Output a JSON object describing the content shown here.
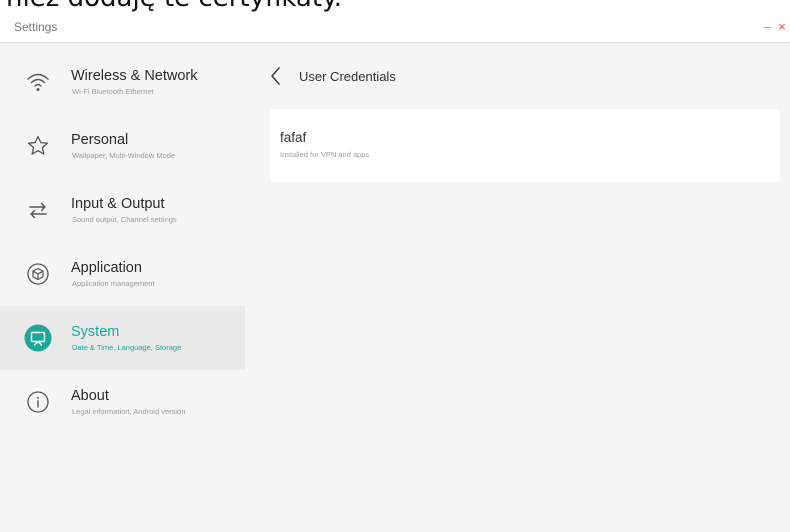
{
  "caption": {
    "text": "niez dodaję te certyfikaty."
  },
  "window": {
    "title": "Settings",
    "minimize_glyph": "–",
    "close_glyph": "×",
    "close_color": "#e0522f"
  },
  "sidebar": {
    "accent_color": "#1aa89a",
    "items": [
      {
        "icon": "wifi-icon",
        "label": "Wireless & Network",
        "sublabel": "Wi-Fi Bluetooth Ethernet",
        "active": false
      },
      {
        "icon": "star-icon",
        "label": "Personal",
        "sublabel": "Wallpaper, Multi-Window Mode",
        "active": false
      },
      {
        "icon": "swap-arrows-icon",
        "label": "Input & Output",
        "sublabel": "Sound output, Channel settings",
        "active": false
      },
      {
        "icon": "cube-icon",
        "label": "Application",
        "sublabel": "Application management",
        "active": false
      },
      {
        "icon": "monitor-icon",
        "label": "System",
        "sublabel": "Date & Time, Language, Storage",
        "active": true
      },
      {
        "icon": "info-icon",
        "label": "About",
        "sublabel": "Legal information, Android version",
        "active": false
      }
    ]
  },
  "content": {
    "back_icon": "chevron-left-icon",
    "title": "User Credentials",
    "credentials": [
      {
        "name": "fafaf",
        "detail": "Installed for VPN and apps"
      }
    ]
  }
}
